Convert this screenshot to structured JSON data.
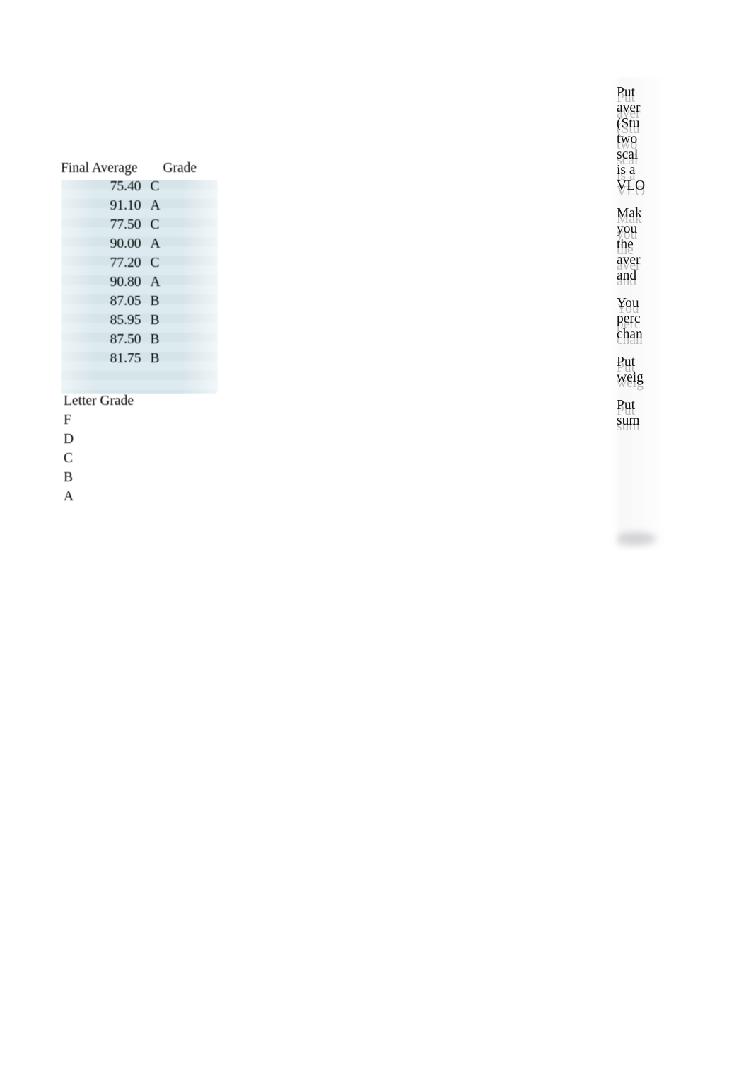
{
  "document": {
    "background_color": "#ffffff",
    "band_color_dark": "#d3e3e9",
    "band_color_light": "#dceaef",
    "text_color": "#000000",
    "ghost_text_color": "#b9b9b9"
  },
  "grade_table": {
    "name": "final-average-grade-table",
    "headers": [
      "Final Average",
      "Grade"
    ],
    "rows": [
      {
        "final_average": "75.40",
        "grade": "C"
      },
      {
        "final_average": "91.10",
        "grade": "A"
      },
      {
        "final_average": "77.50",
        "grade": "C"
      },
      {
        "final_average": "90.00",
        "grade": "A"
      },
      {
        "final_average": "77.20",
        "grade": "C"
      },
      {
        "final_average": "90.80",
        "grade": "A"
      },
      {
        "final_average": "87.05",
        "grade": "B"
      },
      {
        "final_average": "85.95",
        "grade": "B"
      },
      {
        "final_average": "87.50",
        "grade": "B"
      },
      {
        "final_average": "81.75",
        "grade": "B"
      }
    ]
  },
  "letter_grade_list": {
    "heading": "Letter Grade",
    "items": [
      "F",
      "D",
      "C",
      "B",
      "A"
    ]
  },
  "notes": {
    "paragraphs": [
      {
        "lines": [
          "Put",
          "aver",
          "(Stu",
          "two",
          "scal",
          "is a",
          "VLO"
        ]
      },
      {
        "lines": [
          "Mak",
          "you",
          "the",
          "aver",
          "and"
        ]
      },
      {
        "lines": [
          "You",
          "perc",
          "chan"
        ]
      },
      {
        "lines": [
          "Put",
          "weig"
        ]
      },
      {
        "lines": [
          "Put",
          "sum"
        ]
      }
    ]
  }
}
